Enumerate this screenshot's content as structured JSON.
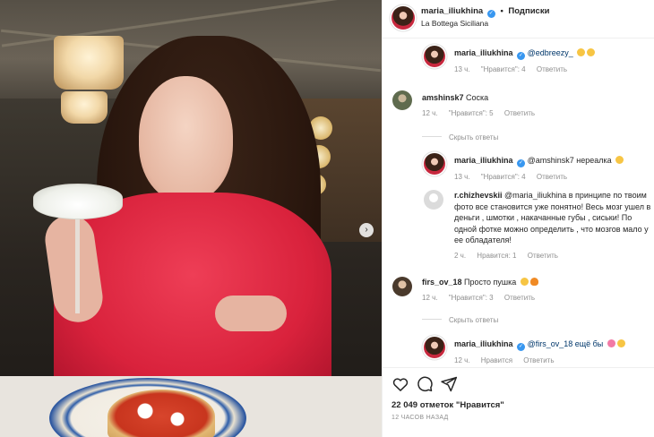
{
  "post": {
    "nav_next_icon": "chevron-right-icon"
  },
  "header": {
    "username": "maria_iliukhina",
    "separator": "•",
    "follow_label": "Подписки",
    "location": "La Bottega Siciliana",
    "verified_icon": "verified-check-icon"
  },
  "comments": [
    {
      "username": "maria_iliukhina",
      "text": "@edbreezy_",
      "emoji": [
        "smirk-emoji",
        "grin-emoji"
      ],
      "time": "13 ч.",
      "likes": "\"Нравится\": 4",
      "reply": "Ответить"
    },
    {
      "username": "amshinsk7",
      "text": "Соска",
      "time": "12 ч.",
      "likes": "\"Нравится\": 5",
      "reply": "Ответить",
      "show_replies": "Скрыть ответы"
    },
    {
      "username": "maria_iliukhina",
      "text": "@amshinsk7 нереалка",
      "emoji": [
        "grin-emoji"
      ],
      "time": "13 ч.",
      "likes": "\"Нравится\": 4",
      "reply": "Ответить"
    },
    {
      "username": "r.chizhevskii",
      "text": "@maria_iliukhina в принципе по твоим фото все становится уже понятно! Весь мозг ушел в деньги , шмотки , накачанные губы , сиськи! По одной фотке можно определить , что мозгов мало у ее обладателя!",
      "time": "2 ч.",
      "likes": "Нравится: 1",
      "reply": "Ответить"
    },
    {
      "username": "firs_ov_18",
      "text": "Просто пушка",
      "emoji": [
        "laughing-emoji",
        "fire-emoji"
      ],
      "time": "12 ч.",
      "likes": "\"Нравится\": 3",
      "reply": "Ответить",
      "show_replies": "Скрыть ответы"
    },
    {
      "username": "maria_iliukhina",
      "text": "@firs_ov_18 ещё бы",
      "emoji": [
        "butterfly-emoji",
        "grin-emoji"
      ],
      "time": "12 ч.",
      "likes": "Нравится",
      "reply": "Ответить"
    }
  ],
  "actions": {
    "like_icon": "heart-icon",
    "comment_icon": "comment-icon",
    "share_icon": "share-icon",
    "likes_text": "22 049 отметок \"Нравится\"",
    "timestamp": "12 ЧАСОВ НАЗАД"
  },
  "colors": {
    "text": "#262626",
    "muted": "#8e8e8e",
    "mention": "#00376b",
    "verified": "#3897f0",
    "border": "#efefef"
  }
}
